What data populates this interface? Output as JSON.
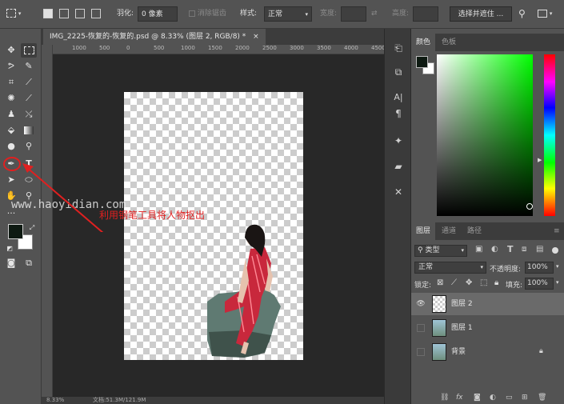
{
  "options_bar": {
    "feather_label": "羽化:",
    "feather_value": "0 像素",
    "antialias_label": "消除锯齿",
    "style_label": "样式:",
    "style_value": "正常",
    "width_label": "宽度:",
    "height_label": "高度:",
    "select_mask_label": "选择并遮住 ..."
  },
  "document": {
    "tab_title": "IMG_2225-恢复的-恢复的.psd @ 8.33% (图层 2, RGB/8) *",
    "ruler_labels": [
      "1000",
      "500",
      "0",
      "500",
      "1000",
      "1500",
      "2000",
      "2500",
      "3000",
      "3500",
      "4000",
      "4500"
    ],
    "status_zoom": "8.33%",
    "status_doc": "文档:51.3M/121.9M"
  },
  "annotation": {
    "watermark": "www.haoyidian.com",
    "text": "利用钢笔工具将人物抠出",
    "color": "#e02020"
  },
  "color_panel": {
    "tabs": [
      "颜色",
      "色板"
    ],
    "foreground": "#0e1a12",
    "background": "#ffffff"
  },
  "layers_panel": {
    "tabs": [
      "图层",
      "通道",
      "路径"
    ],
    "filter_kind": "类型",
    "blend_mode": "正常",
    "opacity_label": "不透明度:",
    "opacity_value": "100%",
    "lock_label": "锁定:",
    "fill_label": "填充:",
    "fill_value": "100%",
    "layers": [
      {
        "name": "图层 2",
        "visible": true,
        "selected": true
      },
      {
        "name": "图层 1",
        "visible": false,
        "selected": false
      },
      {
        "name": "背景",
        "visible": false,
        "selected": false,
        "locked": true
      }
    ]
  }
}
